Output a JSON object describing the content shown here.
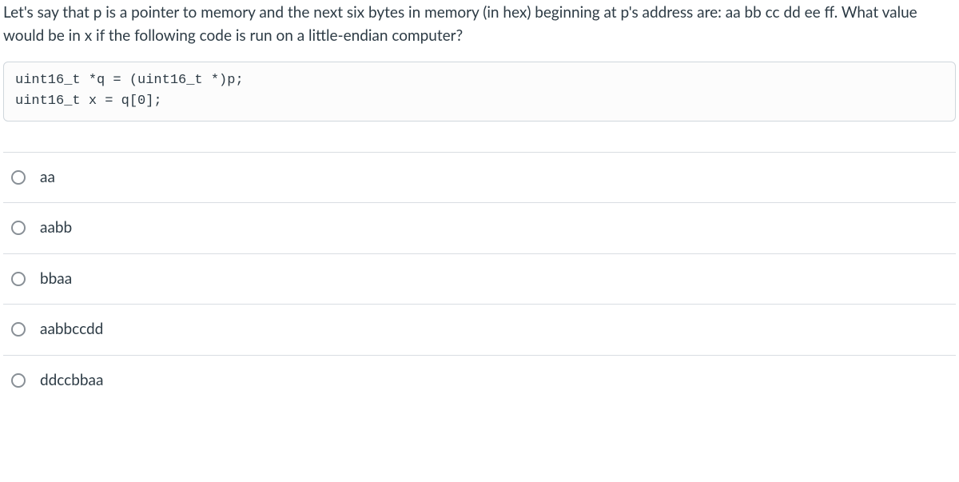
{
  "question_text": "Let's say that p is a pointer to memory and the next six bytes in memory (in hex) beginning at p's address are: aa bb cc dd ee ff. What value would be in x if the following code is run on a little-endian computer?",
  "code_line1": "uint16_t *q = (uint16_t *)p;",
  "code_line2": "uint16_t x = q[0];",
  "options": [
    {
      "label": "aa"
    },
    {
      "label": "aabb"
    },
    {
      "label": "bbaa"
    },
    {
      "label": "aabbccdd"
    },
    {
      "label": "ddccbbaa"
    }
  ]
}
